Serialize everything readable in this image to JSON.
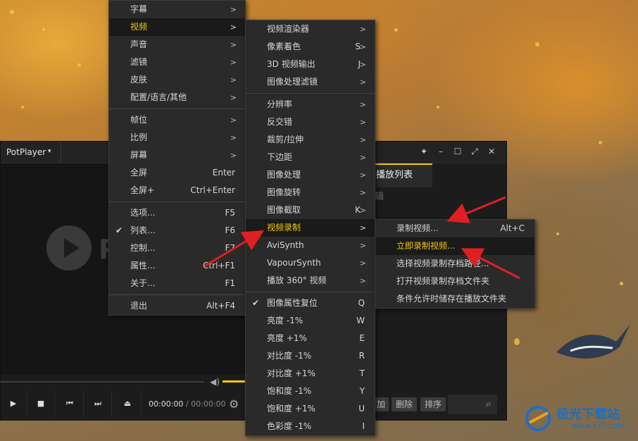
{
  "player": {
    "brand": "PotPlayer",
    "logo_text": "P",
    "time_current": "00:00:00",
    "time_separator": "/",
    "time_total": "00:00:00",
    "volume_level": 1.0
  },
  "playlist": {
    "tab_label": "播放列表",
    "sub_label": "辑",
    "buttons": [
      "加",
      "删除",
      "排序"
    ]
  },
  "menu_main": {
    "items": [
      {
        "label": "字幕",
        "submenu": true
      },
      {
        "label": "视频",
        "submenu": true,
        "highlight": true
      },
      {
        "label": "声音",
        "submenu": true
      },
      {
        "label": "滤镜",
        "submenu": true
      },
      {
        "label": "皮肤",
        "submenu": true
      },
      {
        "label": "配置/语言/其他",
        "submenu": true
      },
      {
        "sep": true
      },
      {
        "label": "帧位",
        "submenu": true
      },
      {
        "label": "比例",
        "submenu": true
      },
      {
        "label": "屏幕",
        "submenu": true
      },
      {
        "label": "全屏",
        "shortcut": "Enter"
      },
      {
        "label": "全屏+",
        "shortcut": "Ctrl+Enter"
      },
      {
        "sep": true
      },
      {
        "label": "选项...",
        "shortcut": "F5"
      },
      {
        "label": "列表...",
        "shortcut": "F6",
        "checked": true
      },
      {
        "label": "控制...",
        "shortcut": "F7"
      },
      {
        "label": "属性...",
        "shortcut": "Ctrl+F1"
      },
      {
        "label": "关于...",
        "shortcut": "F1"
      },
      {
        "sep": true
      },
      {
        "label": "退出",
        "shortcut": "Alt+F4"
      }
    ]
  },
  "menu_video": {
    "items": [
      {
        "label": "视频渲染器",
        "submenu": true
      },
      {
        "label": "像素着色",
        "shortcut": "S",
        "submenu": true
      },
      {
        "label": "3D 视频输出",
        "shortcut": "J",
        "submenu": true
      },
      {
        "label": "图像处理滤镜",
        "submenu": true
      },
      {
        "sep": true
      },
      {
        "label": "分辨率",
        "submenu": true
      },
      {
        "label": "反交错",
        "submenu": true
      },
      {
        "label": "裁剪/拉伸",
        "submenu": true
      },
      {
        "label": "下边距",
        "submenu": true
      },
      {
        "label": "图像处理",
        "submenu": true
      },
      {
        "label": "图像旋转",
        "submenu": true
      },
      {
        "label": "图像截取",
        "shortcut": "K",
        "submenu": true
      },
      {
        "label": "视频录制",
        "submenu": true,
        "highlight": true
      },
      {
        "label": "AviSynth",
        "submenu": true
      },
      {
        "label": "VapourSynth",
        "submenu": true
      },
      {
        "label": "播放 360° 视频",
        "submenu": true
      },
      {
        "sep": true
      },
      {
        "label": "图像属性复位",
        "shortcut": "Q",
        "checked": true
      },
      {
        "label": "亮度 -1%",
        "shortcut": "W"
      },
      {
        "label": "亮度 +1%",
        "shortcut": "E"
      },
      {
        "label": "对比度 -1%",
        "shortcut": "R"
      },
      {
        "label": "对比度 +1%",
        "shortcut": "T"
      },
      {
        "label": "饱和度 -1%",
        "shortcut": "Y"
      },
      {
        "label": "饱和度 +1%",
        "shortcut": "U"
      },
      {
        "label": "色彩度 -1%",
        "shortcut": "I"
      }
    ]
  },
  "menu_record": {
    "items": [
      {
        "label": "录制视频...",
        "shortcut": "Alt+C"
      },
      {
        "label": "立即录制视频...",
        "highlight": true
      },
      {
        "label": "选择视频录制存档路径..."
      },
      {
        "label": "打开视频录制存档文件夹"
      },
      {
        "label": "条件允许时储存在播放文件夹"
      }
    ]
  },
  "watermark": {
    "text": "极光下载站",
    "url": "www.xz7.com"
  },
  "colors": {
    "accent": "#f0c80a",
    "menu_bg": "#2a2a2a",
    "arrow": "#e02020"
  }
}
